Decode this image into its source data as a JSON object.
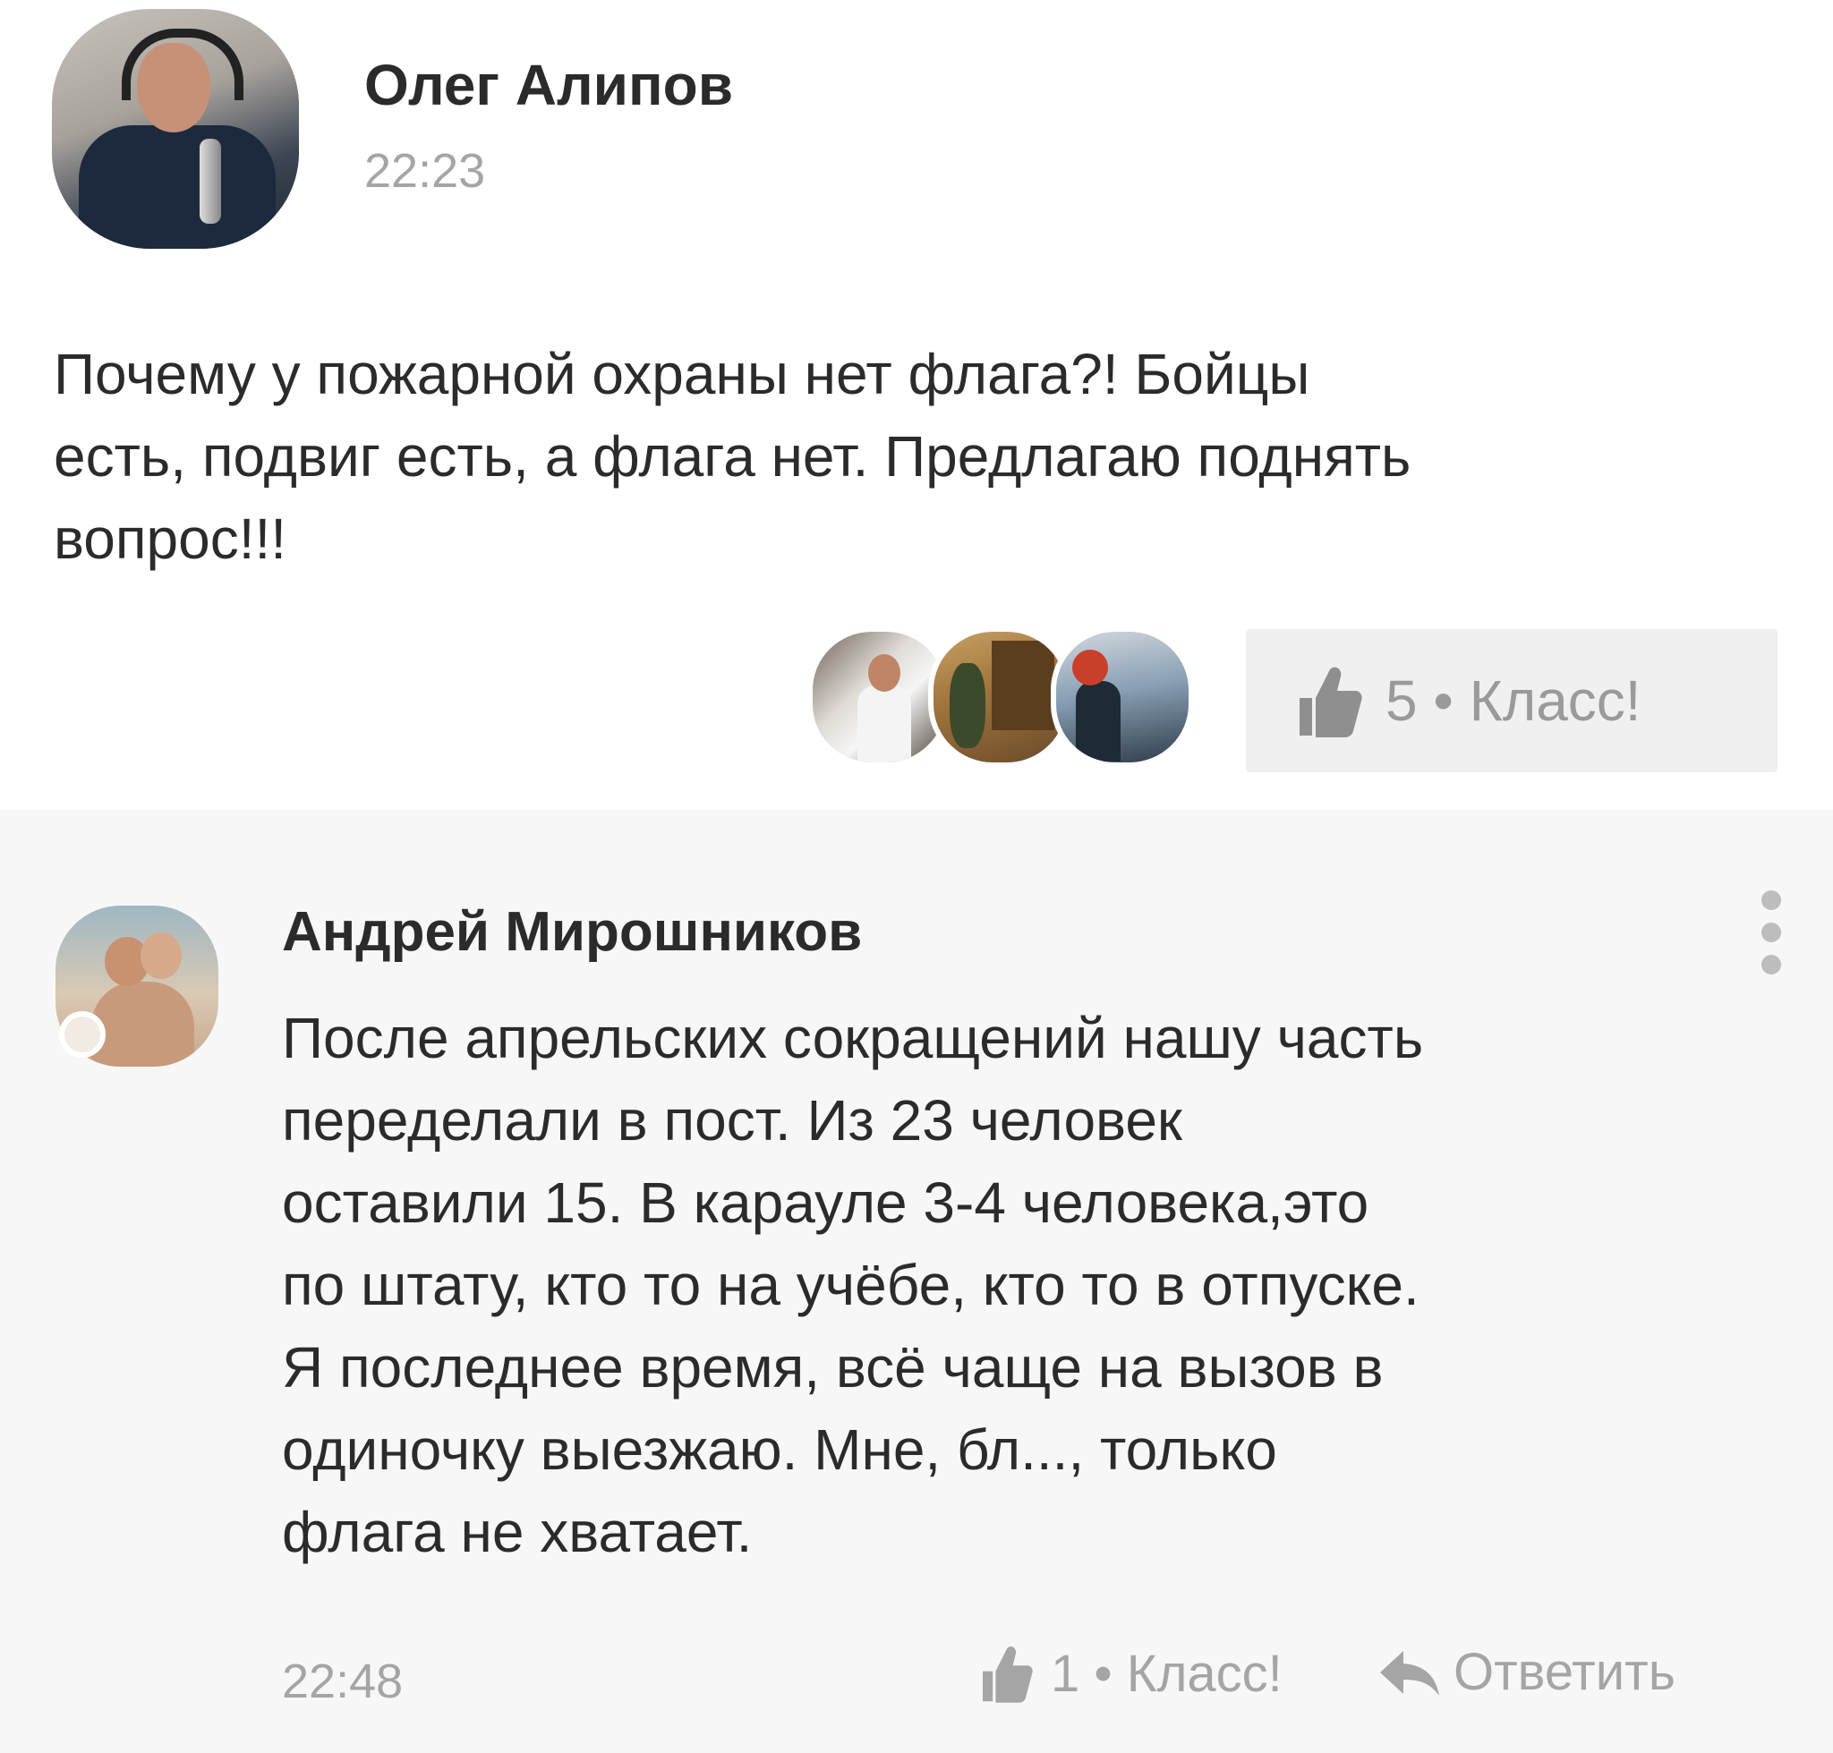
{
  "post": {
    "author": "Олег Алипов",
    "time": "22:23",
    "text": "Почему у пожарной охраны нет флага?! Бойцы\nесть, подвиг есть, а флага нет. Предлагаю поднять\nвопрос!!!",
    "like_label": "5 • Класс!"
  },
  "comment": {
    "author": "Андрей Мирошников",
    "text": "После апрельских сокращений нашу часть\nпеределали в пост. Из 23 человек\nоставили 15. В карауле 3-4 человека,это\nпо штату, кто то на учёбе, кто то в отпуске.\nЯ последнее время, всё чаще на вызов в\nодиночку выезжаю. Мне, бл..., только\nфлага не хватает.",
    "time": "22:48",
    "like_label": "1 • Класс!",
    "reply_label": "Ответить"
  },
  "icons": {
    "like": "thumbs-up-icon",
    "reply": "reply-arrow-icon",
    "menu": "more-vertical-icon"
  },
  "colors": {
    "text": "#2b2b2b",
    "muted": "#a5a5a5",
    "like_box_bg": "#f0f0f0",
    "comment_bg": "#f7f7f7"
  }
}
